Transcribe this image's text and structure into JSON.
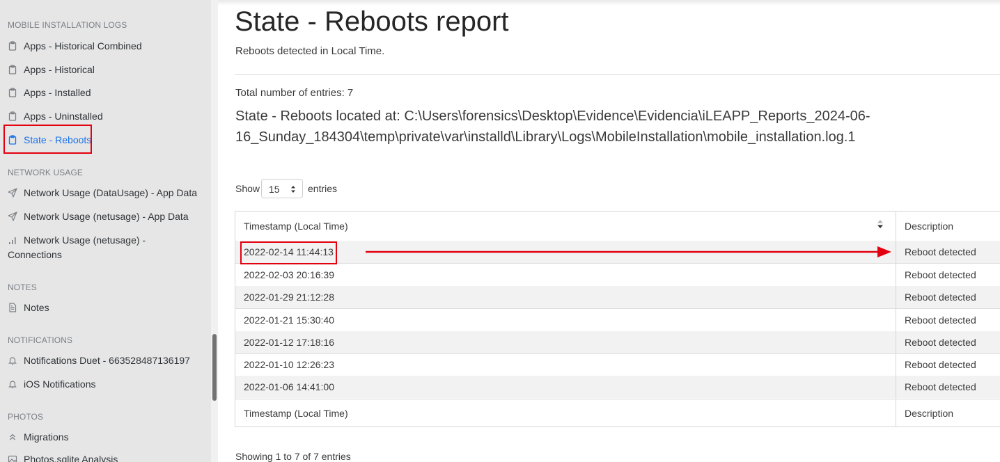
{
  "sidebar": {
    "sections": [
      {
        "title": "MOBILE INSTALLATION LOGS",
        "items": [
          {
            "label": "Apps - Historical Combined",
            "icon": "clipboard-icon"
          },
          {
            "label": "Apps - Historical",
            "icon": "clipboard-icon"
          },
          {
            "label": "Apps - Installed",
            "icon": "clipboard-icon"
          },
          {
            "label": "Apps - Uninstalled",
            "icon": "clipboard-icon"
          },
          {
            "label": "State - Reboots",
            "icon": "clipboard-icon",
            "active": true
          }
        ]
      },
      {
        "title": "NETWORK USAGE",
        "items": [
          {
            "label": "Network Usage (DataUsage) - App Data",
            "icon": "send-icon"
          },
          {
            "label": "Network Usage (netusage) - App Data",
            "icon": "send-icon"
          },
          {
            "label_line1": "Network Usage (netusage) -",
            "label_line2": "Connections",
            "icon": "signal-bars-icon"
          }
        ]
      },
      {
        "title": "NOTES",
        "items": [
          {
            "label": "Notes",
            "icon": "file-text-icon"
          }
        ]
      },
      {
        "title": "NOTIFICATIONS",
        "items": [
          {
            "label": "Notifications Duet - 663528487136197",
            "icon": "bell-icon"
          },
          {
            "label": "iOS Notifications",
            "icon": "bell-icon"
          }
        ]
      },
      {
        "title": "PHOTOS",
        "items": [
          {
            "label": "Migrations",
            "icon": "chevrons-up-icon"
          },
          {
            "label": "Photos.sqlite Analysis",
            "icon": "image-icon"
          }
        ]
      }
    ]
  },
  "main": {
    "title": "State - Reboots report",
    "subtitle": "Reboots detected in Local Time.",
    "total_entries": "Total number of entries: 7",
    "location": "State - Reboots located at: C:\\Users\\forensics\\Desktop\\Evidence\\Evidencia\\iLEAPP_Reports_2024-06-16_Sunday_184304\\temp\\private\\var\\installd\\Library\\Logs\\MobileInstallation\\mobile_installation.log.1",
    "show_label": "Show",
    "page_size": "15",
    "entries_label": "entries",
    "table": {
      "columns": [
        "Timestamp (Local Time)",
        "Description"
      ],
      "rows": [
        [
          "2022-02-14 11:44:13",
          "Reboot detected"
        ],
        [
          "2022-02-03 20:16:39",
          "Reboot detected"
        ],
        [
          "2022-01-29 21:12:28",
          "Reboot detected"
        ],
        [
          "2022-01-21 15:30:40",
          "Reboot detected"
        ],
        [
          "2022-01-12 17:18:16",
          "Reboot detected"
        ],
        [
          "2022-01-10 12:26:23",
          "Reboot detected"
        ],
        [
          "2022-01-06 14:41:00",
          "Reboot detected"
        ]
      ]
    },
    "info": "Showing 1 to 7 of 7 entries"
  },
  "colors": {
    "sidebar_bg": "#e6e6e6",
    "active_link": "#1a73e8",
    "annotation_red": "#e3000f",
    "odd_row": "#f2f2f2"
  }
}
